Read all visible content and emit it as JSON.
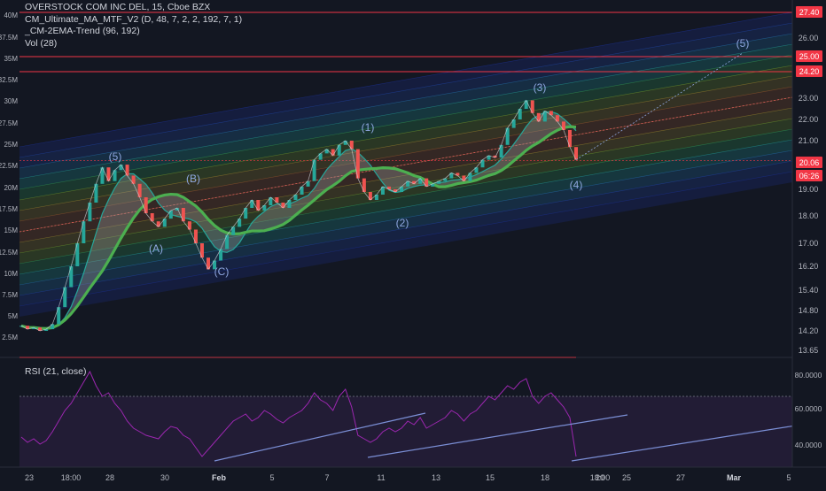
{
  "header": {
    "symbol_line": "OVERSTOCK COM INC DEL, 15, Cboe BZX",
    "indicators": [
      "CM_Ultimate_MA_MTF_V2 (D, 48, 7, 2, 2, 192, 7, 1)",
      "_CM-2EMA-Trend (96, 192)",
      "Vol (28)"
    ]
  },
  "rsi": {
    "label": "RSI (21, close)",
    "ticks": [
      "80.0000",
      "60.0000",
      "40.0000"
    ]
  },
  "price_axis": {
    "ticks": [
      "26.00",
      "25.00",
      "24.20",
      "23.00",
      "22.00",
      "21.00",
      "20.00",
      "19.00",
      "18.00",
      "17.00",
      "16.20",
      "15.40",
      "14.80",
      "14.20",
      "13.65"
    ],
    "badges": [
      {
        "text": "27.40",
        "color": "#f23645"
      },
      {
        "text": "25.00",
        "color": "#f23645"
      },
      {
        "text": "24.20",
        "color": "#f23645"
      },
      {
        "text": "20.06",
        "color": "#f23645"
      },
      {
        "text": "06:26",
        "color": "#f23645"
      }
    ]
  },
  "volume_axis": {
    "ticks": [
      "40M",
      "37.5M",
      "35M",
      "32.5M",
      "30M",
      "27.5M",
      "25M",
      "22.5M",
      "20M",
      "17.5M",
      "15M",
      "12.5M",
      "10M",
      "7.5M",
      "5M",
      "2.5M"
    ]
  },
  "time_axis": {
    "ticks": [
      "23",
      "18:00",
      "28",
      "30",
      "Feb",
      "5",
      "7",
      "11",
      "13",
      "15",
      "18",
      "20",
      "18:00",
      "25",
      "27",
      "Mar",
      "5"
    ]
  },
  "wave_labels": [
    "(5)",
    "(A)",
    "(B)",
    "(C)",
    "(1)",
    "(2)",
    "(3)",
    "(4)",
    "(5)"
  ],
  "chart_data": {
    "type": "line",
    "title": "OVERSTOCK COM INC DEL, 15, Cboe BZX",
    "price_series": {
      "name": "OSTK 15m close (approx.)",
      "values": [
        14.35,
        14.25,
        14.3,
        14.2,
        14.25,
        14.4,
        14.9,
        15.5,
        16.2,
        17.0,
        17.8,
        18.5,
        19.2,
        19.8,
        19.3,
        19.7,
        19.9,
        19.5,
        19.2,
        18.7,
        18.1,
        17.8,
        17.6,
        17.9,
        18.2,
        18.3,
        17.8,
        17.5,
        17.0,
        16.5,
        16.1,
        16.4,
        16.8,
        17.3,
        17.6,
        17.9,
        18.3,
        18.6,
        18.2,
        18.4,
        18.7,
        18.5,
        18.3,
        18.6,
        18.8,
        19.1,
        19.3,
        20.1,
        20.4,
        20.6,
        20.3,
        20.8,
        21.0,
        20.6,
        19.4,
        18.9,
        18.6,
        18.8,
        19.1,
        19.0,
        18.9,
        19.1,
        19.3,
        19.2,
        19.4,
        19.1,
        19.2,
        19.3,
        19.4,
        19.6,
        19.5,
        19.3,
        19.6,
        19.8,
        20.1,
        20.3,
        20.2,
        20.8,
        21.6,
        22.0,
        22.5,
        22.9,
        22.3,
        21.9,
        22.4,
        22.2,
        21.9,
        21.5,
        20.7,
        20.1
      ]
    },
    "rsi_series": {
      "name": "RSI (21, close)",
      "values": [
        47,
        44,
        46,
        43,
        45,
        50,
        56,
        62,
        66,
        72,
        78,
        84,
        76,
        70,
        72,
        66,
        62,
        56,
        52,
        50,
        48,
        47,
        46,
        50,
        53,
        52,
        48,
        46,
        41,
        36,
        40,
        44,
        48,
        52,
        56,
        58,
        60,
        56,
        58,
        62,
        60,
        57,
        55,
        58,
        60,
        62,
        66,
        72,
        68,
        66,
        62,
        70,
        74,
        64,
        48,
        46,
        44,
        46,
        50,
        52,
        50,
        52,
        56,
        54,
        58,
        52,
        54,
        56,
        58,
        62,
        60,
        56,
        60,
        62,
        66,
        70,
        68,
        72,
        76,
        74,
        78,
        80,
        70,
        66,
        70,
        72,
        68,
        64,
        58,
        36
      ]
    },
    "axes": {
      "price_range": [
        13.65,
        27.4
      ],
      "volume_range": [
        0,
        40000000
      ],
      "rsi_range": [
        30,
        90
      ]
    },
    "horizontal_levels": [
      27.4,
      25.0,
      24.2,
      20.06
    ],
    "rsi_bands": [
      70,
      30
    ],
    "grid": false
  },
  "colors": {
    "background": "#131722",
    "price_line": "#d1d4dc",
    "ma_fast": "#26a69a",
    "ma_slow": "#4caf50",
    "level_line": "#f23645",
    "rsi_line": "#9c27b0",
    "rsi_band_fill": "#2a1f3d",
    "trendline": "#7b8fd6",
    "wave_label": "#8fa7e0"
  }
}
